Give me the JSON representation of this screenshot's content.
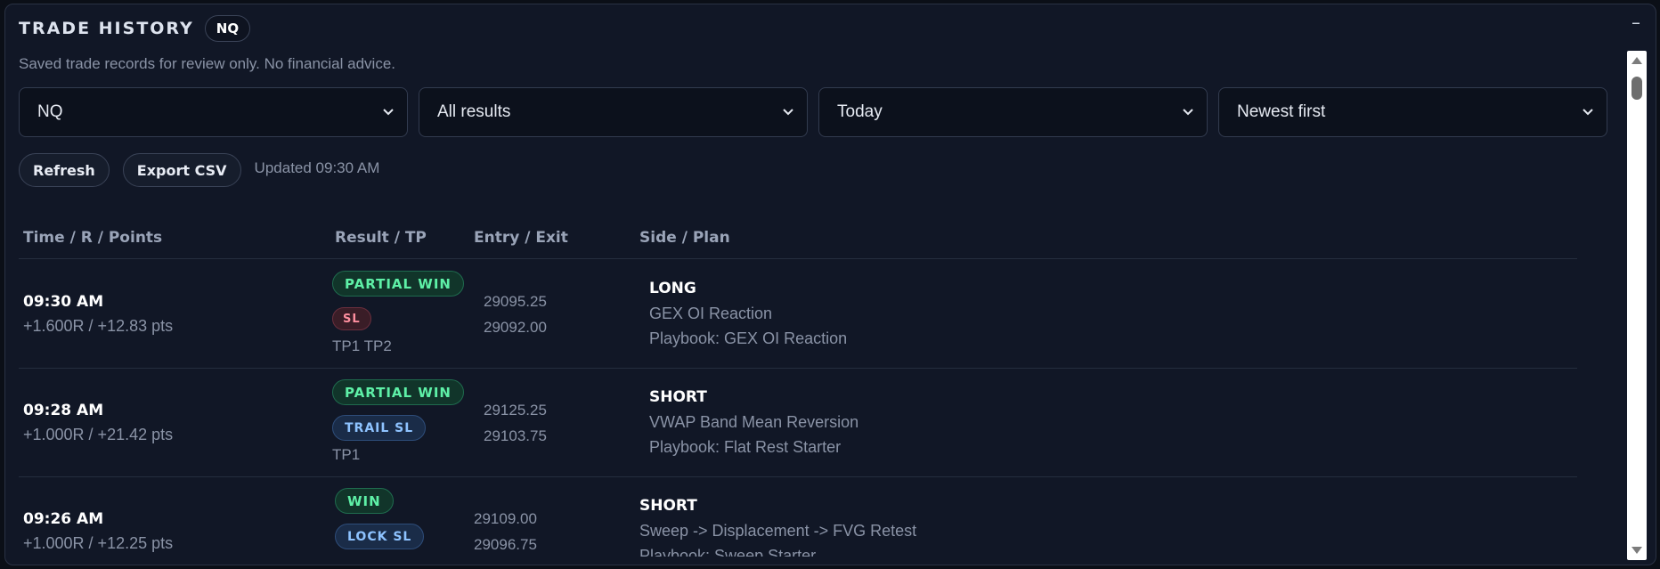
{
  "header": {
    "title": "TRADE HISTORY",
    "instrument_badge": "NQ",
    "minimize_label": "–"
  },
  "disclaimer": "Saved trade records for review only. No financial advice.",
  "filters": {
    "instrument": "NQ",
    "result": "All results",
    "period": "Today",
    "sort": "Newest first"
  },
  "actions": {
    "refresh_label": "Refresh",
    "export_label": "Export CSV",
    "updated_text": "Updated 09:30 AM"
  },
  "table": {
    "columns": [
      "Time / R / Points",
      "Result / TP",
      "Entry / Exit",
      "Side / Plan"
    ],
    "rows": [
      {
        "time": "09:30 AM",
        "r_points": "+1.600R / +12.83 pts",
        "result": "PARTIAL WIN",
        "stop": "SL",
        "tp": "TP1 TP2",
        "entry": "29095.25",
        "exit": "29092.00",
        "side": "LONG",
        "setup": "GEX OI Reaction",
        "playbook": "Playbook: GEX OI Reaction"
      },
      {
        "time": "09:28 AM",
        "r_points": "+1.000R / +21.42 pts",
        "result": "PARTIAL WIN",
        "stop": "TRAIL SL",
        "tp": "TP1",
        "entry": "29125.25",
        "exit": "29103.75",
        "side": "SHORT",
        "setup": "VWAP Band Mean Reversion",
        "playbook": "Playbook: Flat Rest Starter"
      },
      {
        "time": "09:26 AM",
        "r_points": "+1.000R / +12.25 pts",
        "result": "WIN",
        "stop": "LOCK SL",
        "tp": "",
        "entry": "29109.00",
        "exit": "29096.75",
        "side": "SHORT",
        "setup": "Sweep -> Displacement -> FVG Retest",
        "playbook": "Playbook: Sweep Starter"
      }
    ]
  },
  "colors": {
    "panel_bg": "#111726",
    "win": "#5ef0a7",
    "stop_loss": "#ff8f9f",
    "trail": "#8ec3ff"
  }
}
